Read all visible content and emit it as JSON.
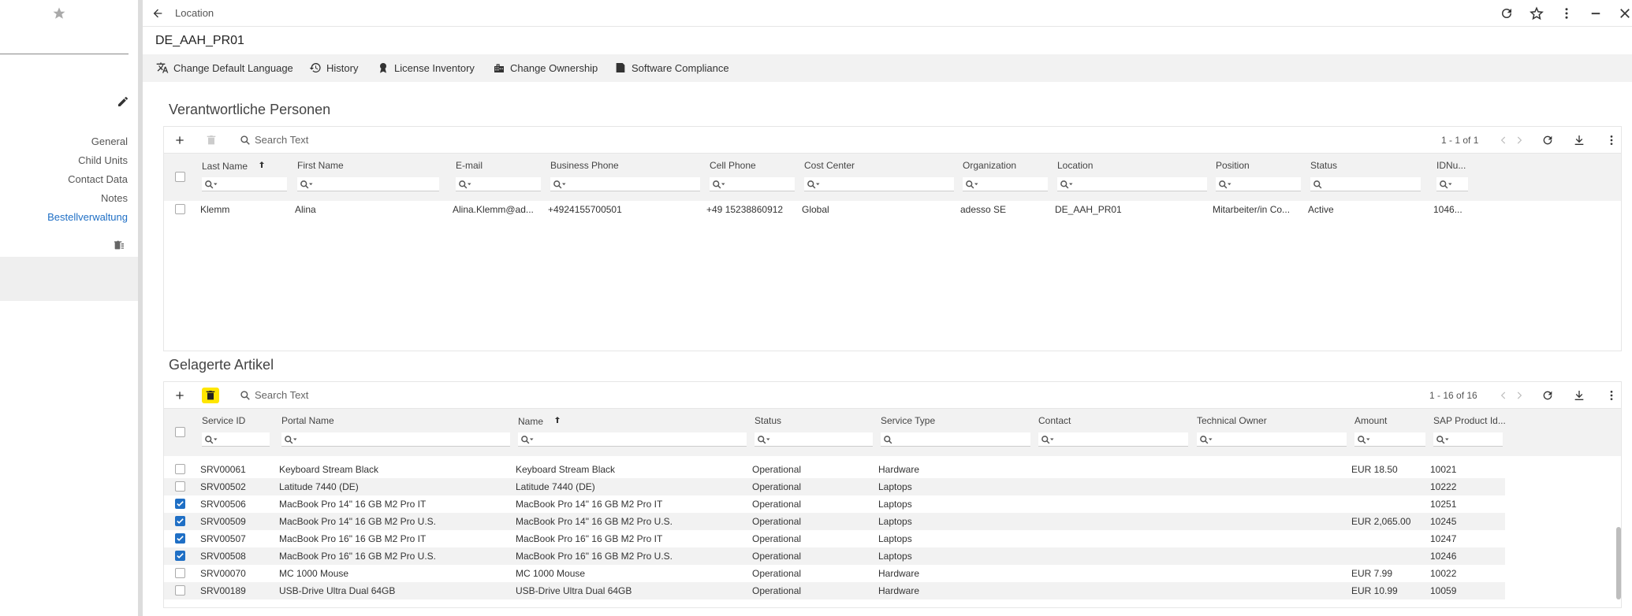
{
  "window": {
    "title": "Location",
    "record_title": "DE_AAH_PR01"
  },
  "actions": [
    {
      "label": "Change Default Language",
      "icon": "translate-icon"
    },
    {
      "label": "History",
      "icon": "history-icon"
    },
    {
      "label": "License Inventory",
      "icon": "license-icon"
    },
    {
      "label": "Change Ownership",
      "icon": "ownership-icon"
    },
    {
      "label": "Software Compliance",
      "icon": "compliance-icon"
    }
  ],
  "sidebar": {
    "items": [
      {
        "label": "General",
        "active": false
      },
      {
        "label": "Child Units",
        "active": false
      },
      {
        "label": "Contact Data",
        "active": false
      },
      {
        "label": "Notes",
        "active": false
      },
      {
        "label": "Bestellverwaltung",
        "active": true
      }
    ]
  },
  "persons": {
    "title": "Verantwortliche Personen",
    "search_placeholder": "Search Text",
    "pager": "1 - 1 of 1",
    "columns": [
      "Last Name",
      "First Name",
      "E-mail",
      "Business Phone",
      "Cell Phone",
      "Cost Center",
      "Organization",
      "Location",
      "Position",
      "Status",
      "IDNu..."
    ],
    "rows": [
      [
        "Klemm",
        "Alina",
        "Alina.Klemm@ad...",
        "+4924155700501",
        "+49 15238860912",
        "Global",
        "adesso SE",
        "DE_AAH_PR01",
        "Mitarbeiter/in Co...",
        "Active",
        "1046..."
      ]
    ]
  },
  "articles": {
    "title": "Gelagerte Artikel",
    "search_placeholder": "Search Text",
    "pager": "1 - 16 of 16",
    "columns": [
      "Service ID",
      "Portal Name",
      "Name",
      "Status",
      "Service Type",
      "Contact",
      "Technical Owner",
      "Amount",
      "SAP Product Id..."
    ],
    "rows": [
      {
        "checked": false,
        "cells": [
          "SRV00061",
          "Keyboard Stream Black",
          "Keyboard Stream Black",
          "Operational",
          "Hardware",
          "",
          "",
          "EUR 18.50",
          "10021"
        ]
      },
      {
        "checked": false,
        "cells": [
          "SRV00502",
          "Latitude 7440 (DE)",
          "Latitude 7440 (DE)",
          "Operational",
          "Laptops",
          "",
          "",
          "",
          "10222"
        ]
      },
      {
        "checked": true,
        "cells": [
          "SRV00506",
          "MacBook Pro 14\" 16 GB M2 Pro IT",
          "MacBook Pro 14\" 16 GB M2 Pro IT",
          "Operational",
          "Laptops",
          "",
          "",
          "",
          "10251"
        ]
      },
      {
        "checked": true,
        "cells": [
          "SRV00509",
          "MacBook Pro 14\" 16 GB M2 Pro U.S.",
          "MacBook Pro 14\" 16 GB M2 Pro U.S.",
          "Operational",
          "Laptops",
          "",
          "",
          "EUR 2,065.00",
          "10245"
        ]
      },
      {
        "checked": true,
        "cells": [
          "SRV00507",
          "MacBook Pro 16\" 16 GB M2 Pro IT",
          "MacBook Pro 16\" 16 GB M2 Pro IT",
          "Operational",
          "Laptops",
          "",
          "",
          "",
          "10247"
        ]
      },
      {
        "checked": true,
        "cells": [
          "SRV00508",
          "MacBook Pro 16\" 16 GB M2 Pro U.S.",
          "MacBook Pro 16\" 16 GB M2 Pro U.S.",
          "Operational",
          "Laptops",
          "",
          "",
          "",
          "10246"
        ]
      },
      {
        "checked": false,
        "cells": [
          "SRV00070",
          "MC 1000 Mouse",
          "MC 1000 Mouse",
          "Operational",
          "Hardware",
          "",
          "",
          "EUR 7.99",
          "10022"
        ]
      },
      {
        "checked": false,
        "cells": [
          "SRV00189",
          "USB-Drive Ultra Dual 64GB",
          "USB-Drive Ultra Dual 64GB",
          "Operational",
          "Hardware",
          "",
          "",
          "EUR 10.99",
          "10059"
        ]
      }
    ]
  },
  "colors": {
    "accent": "#1f6fc5",
    "highlight": "#ffe600"
  }
}
